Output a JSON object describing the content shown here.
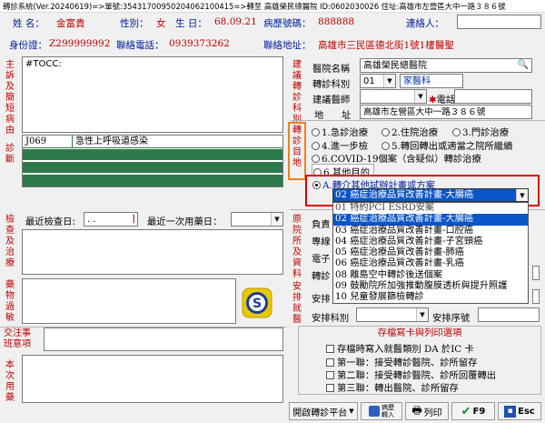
{
  "window": {
    "title": "轉診系統(Ver.20240619)=>單號:35431700950204062100415=>轉至 高雄榮民總醫院 ID:0602030026 住址:高雄市左營區大中一路３８６號"
  },
  "patient": {
    "name_label": "姓  名：",
    "name": "金富貴",
    "sex_label": "性別：",
    "sex": "女",
    "birth_label": "生  日：",
    "birth": "68.09.21",
    "chart_no_label": "病歷號碼：",
    "chart_no": "888888",
    "contact_label": "連絡人：",
    "contact": "",
    "id_label": "身份證：",
    "id": "Z299999992",
    "phone_label": "聯絡電話：",
    "phone": "0939373262",
    "address_label": "聯絡地址：",
    "address": "高雄市三民區德北街1號1樓醫聖"
  },
  "side_labels": {
    "complaint": "主訴及簡短病由",
    "diagnosis": "診斷",
    "exam": "檢查及治療",
    "allergy": "藥物過敏",
    "notes": "交注事班意項",
    "subject": "本次用藥",
    "referral_type": "建議轉診科別",
    "purpose": "轉診目地",
    "hospital": "原院所及資料",
    "arrange": "安排就醫"
  },
  "complaint": {
    "text": "#TOCC:"
  },
  "diagnosis": {
    "rows": [
      {
        "code": "J069",
        "desc": "急性上呼吸道感染"
      },
      {
        "code": "",
        "desc": ""
      },
      {
        "code": "",
        "desc": ""
      },
      {
        "code": "",
        "desc": ""
      }
    ]
  },
  "exam": {
    "last_exam_label": "最近檢查日:",
    "last_exam_value": ". .",
    "last_med_label": "最近一次用藥日："
  },
  "referral": {
    "hospital_label": "醫院名稱",
    "hospital": "高雄榮民總醫院",
    "dept_label": "轉診科別",
    "dept_code": "01",
    "dept_name": "家醫科",
    "doctor_label": "建議醫師",
    "phone_label": "電話",
    "address_label1": "地",
    "address_label2": "址",
    "address": "高雄市左營區大中一路３８６號"
  },
  "purpose": {
    "options": [
      "1.急診治療",
      "2.住院治療",
      "3.門診治療",
      "4.進一步檢",
      "5.轉回轉出或適當之院所繼續",
      "6.COVID-19個案（含疑似）轉診治療",
      "6.其他目的"
    ],
    "selected_option": "A.轉介其他試辦計畫或方案",
    "selected_plan": "02 癌症治療品質改善計畫-大腸癌"
  },
  "dropdown": {
    "items": [
      "01 特約PCI ESRD安案",
      "02 癌症治療品質改善計畫-大腸癌",
      "03 癌症治療品質改善計畫-口腔癌",
      "04 癌症治療品質改善計畫-子宮頸癌",
      "05 癌症治療品質改善計畫-肺癌",
      "06 癌症治療品質改善計畫-乳癌",
      "08 離島空中轉診後送個案",
      "09 鼓勵院所加強推動腹膜透析與提升照護",
      "10 兒童發展篩檢轉診"
    ],
    "selected_index": 1
  },
  "hospital_info": {
    "labels": [
      "負責",
      "專線",
      "電子",
      "轉診",
      "安排"
    ]
  },
  "arrange": {
    "dept_label": "安排科別",
    "seq_label": "安排序號"
  },
  "print_options": {
    "title": "存檔寫卡與列印選項",
    "items": [
      "存檔時寫入就醫類別 DA 於IC 卡",
      "第一聯：接受轉診醫院、診所留存",
      "第二聯：接受轉診醫院、診所回覆轉出",
      "第三聯：轉出醫院、診所留存"
    ]
  },
  "buttons": {
    "platform": "開啟轉診平台",
    "history": "病歷\n轉入",
    "print": "列印",
    "f9": "F9",
    "esc": "Esc"
  },
  "colors": {
    "highlight_red": "#e00000",
    "highlight_orange": "#f08020",
    "selection_blue": "#0a55c8",
    "diagnosis_green": "#2f7a4a"
  }
}
